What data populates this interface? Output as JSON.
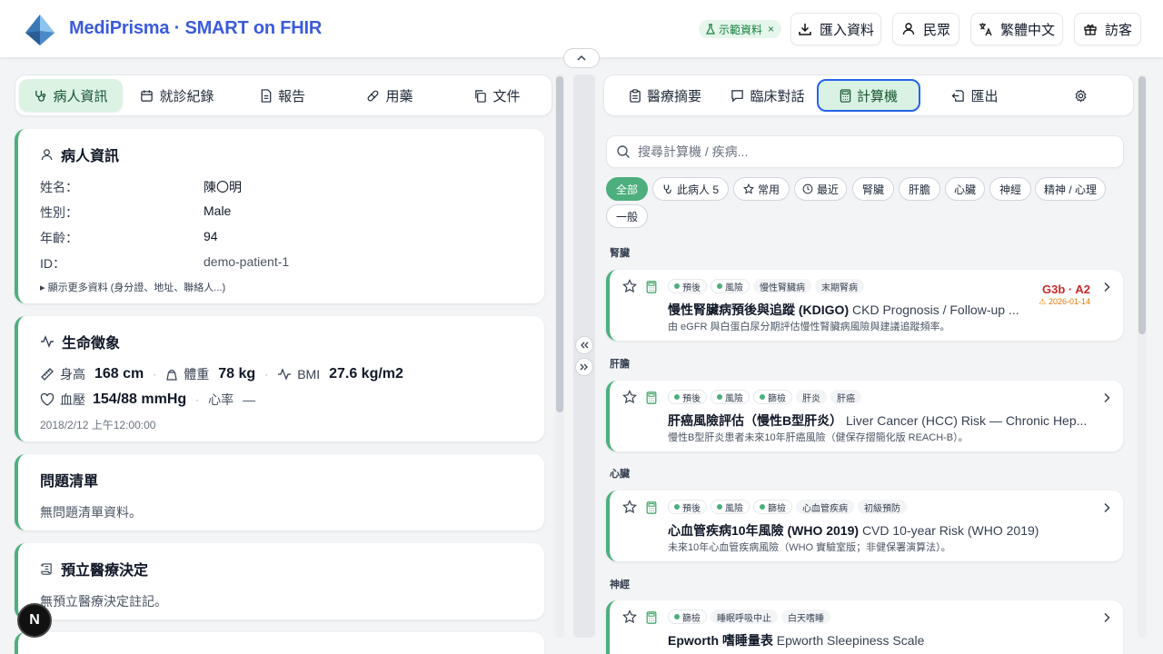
{
  "header": {
    "brand": "MediPrisma · SMART on FHIR",
    "demo_badge": "示範資料",
    "buttons": {
      "import": "匯入資料",
      "public": "民眾",
      "language": "繁體中文",
      "guest": "訪客"
    }
  },
  "left_tabs": [
    "病人資訊",
    "就診紀錄",
    "報告",
    "用藥",
    "文件"
  ],
  "patient": {
    "title": "病人資訊",
    "fields": [
      {
        "label": "姓名：",
        "value": "陳〇明"
      },
      {
        "label": "性別：",
        "value": "Male"
      },
      {
        "label": "年齡：",
        "value": "94"
      },
      {
        "label": "ID：",
        "value": "demo-patient-1"
      }
    ],
    "more": "▸ 顯示更多資料 (身分證、地址、聯絡人...)"
  },
  "vitals": {
    "title": "生命徵象",
    "height_label": "身高",
    "height_value": "168 cm",
    "weight_label": "體重",
    "weight_value": "78 kg",
    "bmi_label": "BMI",
    "bmi_value": "27.6 kg/m2",
    "bp_label": "血壓",
    "bp_value": "154/88 mmHg",
    "hr_label": "心率",
    "hr_value": "—",
    "date": "2018/2/12 上午12:00:00"
  },
  "problems": {
    "title": "問題清單",
    "empty": "無問題清單資料。"
  },
  "advance": {
    "title": "預立醫療決定",
    "empty": "無預立醫療決定註記。"
  },
  "right_tabs": [
    "醫療摘要",
    "臨床對話",
    "計算機",
    "匯出"
  ],
  "search": {
    "placeholder": "搜尋計算機 / 疾病..."
  },
  "filters": [
    "全部",
    "此病人 5",
    "常用",
    "最近",
    "腎臟",
    "肝膽",
    "心臟",
    "神經",
    "精神 / 心理",
    "一般"
  ],
  "sections": {
    "kidney": "腎臟",
    "liver": "肝膽",
    "heart": "心臟",
    "neuro": "神經"
  },
  "calculators": [
    {
      "tags": [
        "預後",
        "風險"
      ],
      "plain_tags": [
        "慢性腎臟病",
        "末期腎病"
      ],
      "title": "慢性腎臟病預後與追蹤 (KDIGO)",
      "title_en": "CKD Prognosis / Follow-up ...",
      "desc": "由 eGFR 與白蛋白尿分期評估慢性腎臟病風險與建議追蹤頻率。",
      "result": "G3b · A2",
      "result_date": "⚠ 2026-01-14"
    },
    {
      "tags": [
        "預後",
        "風險",
        "篩檢"
      ],
      "plain_tags": [
        "肝炎",
        "肝癌"
      ],
      "title": "肝癌風險評估（慢性B型肝炎）",
      "title_en": "Liver Cancer (HCC) Risk — Chronic Hep...",
      "desc": "慢性B型肝炎患者未來10年肝癌風險（健保存摺簡化版 REACH-B）。"
    },
    {
      "tags": [
        "預後",
        "風險",
        "篩檢"
      ],
      "plain_tags": [
        "心血管疾病",
        "初級預防"
      ],
      "title": "心血管疾病10年風險 (WHO 2019)",
      "title_en": "CVD 10-year Risk (WHO 2019)",
      "desc": "未來10年心血管疾病風險（WHO 實驗室版；非健保署演算法）。"
    },
    {
      "tags": [
        "篩檢"
      ],
      "plain_tags": [
        "睡眠呼吸中止",
        "白天嗜睡"
      ],
      "title": "Epworth 嗜睡量表",
      "title_en": "Epworth Sleepiness Scale",
      "desc": ""
    }
  ],
  "fab": "N"
}
